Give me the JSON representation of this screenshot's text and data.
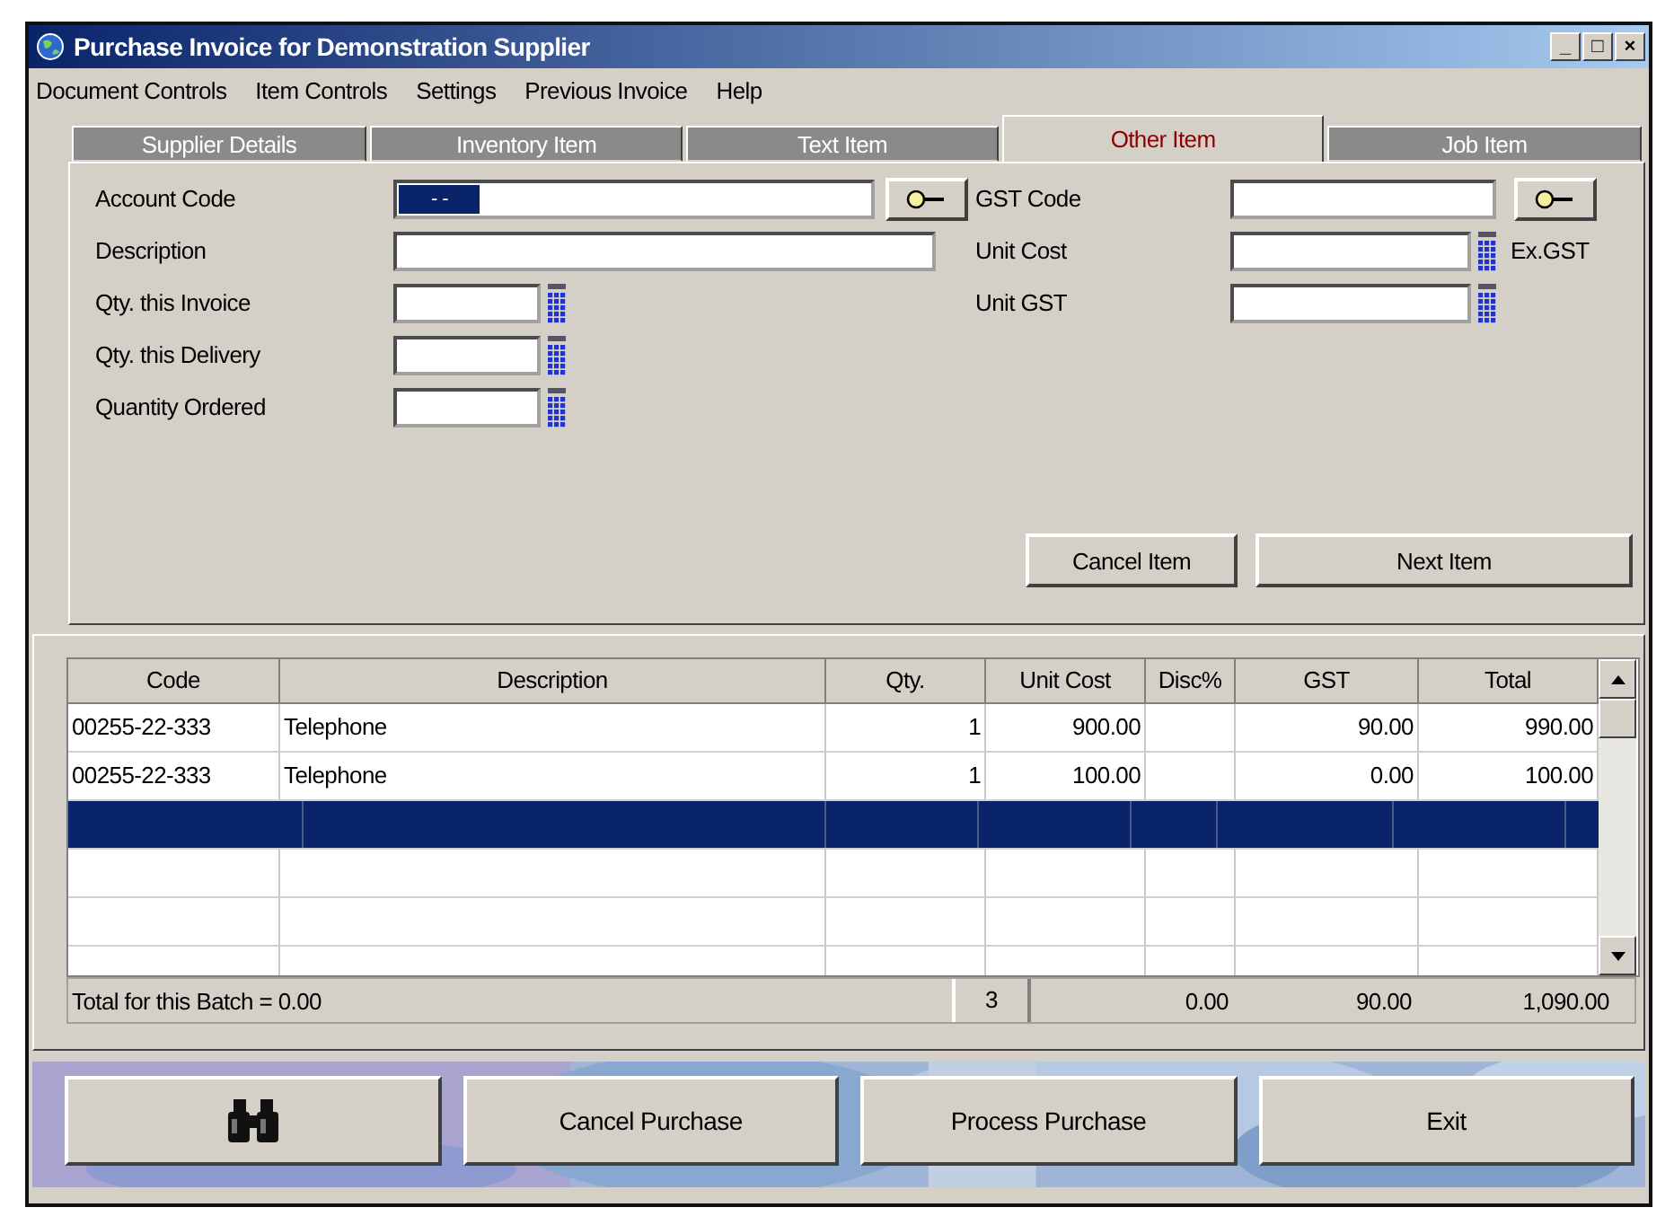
{
  "window": {
    "title": "Purchase Invoice for Demonstration Supplier",
    "controls": [
      "_",
      "□",
      "×"
    ]
  },
  "menu": [
    "Document Controls",
    "Item Controls",
    "Settings",
    "Previous Invoice",
    "Help"
  ],
  "tabs": [
    {
      "label": "Supplier Details",
      "selected": false
    },
    {
      "label": "Inventory Item",
      "selected": false
    },
    {
      "label": "Text Item",
      "selected": false
    },
    {
      "label": "Other Item",
      "selected": true
    },
    {
      "label": "Job Item",
      "selected": false
    }
  ],
  "form_left": [
    {
      "label": "Account Code",
      "kind": "lookup",
      "value": "- -"
    },
    {
      "label": "Description",
      "kind": "text"
    },
    {
      "label": "Qty. this Invoice",
      "kind": "number"
    },
    {
      "label": "Qty. this Delivery",
      "kind": "number"
    },
    {
      "label": "Quantity Ordered",
      "kind": "number"
    }
  ],
  "form_right": [
    {
      "label": "GST Code",
      "kind": "lookup"
    },
    {
      "label": "Unit Cost",
      "kind": "number",
      "note": "Ex.GST"
    },
    {
      "label": "Unit GST",
      "kind": "number"
    }
  ],
  "item_buttons": [
    "Cancel Item",
    "Next Item"
  ],
  "table": {
    "columns": [
      "Code",
      "Description",
      "Qty.",
      "Unit Cost",
      "Disc%",
      "GST",
      "Total"
    ],
    "rows": [
      {
        "cells": [
          "00255-22-333",
          "Telephone",
          "1",
          "900.00",
          "",
          "90.00",
          "990.00"
        ],
        "selected": false
      },
      {
        "cells": [
          "00255-22-333",
          "Telephone",
          "1",
          "100.00",
          "",
          "0.00",
          "100.00"
        ],
        "selected": false
      },
      {
        "cells": [
          "",
          "",
          "",
          "",
          "",
          "",
          ""
        ],
        "selected": true
      }
    ],
    "footer": {
      "label": "Total for this Batch = 0.00",
      "count": "3",
      "disc": "0.00",
      "gst": "90.00",
      "total": "1,090.00"
    }
  },
  "bottom_buttons": [
    {
      "kind": "icon"
    },
    {
      "kind": "text",
      "label": "Cancel Purchase"
    },
    {
      "kind": "text",
      "label": "Process Purchase"
    },
    {
      "kind": "text",
      "label": "Exit"
    }
  ]
}
